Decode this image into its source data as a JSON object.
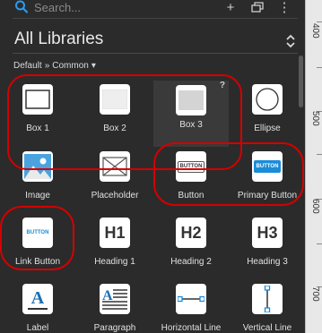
{
  "search": {
    "placeholder": "Search..."
  },
  "toolbar": {
    "add_label": "+",
    "more_label": "⋮"
  },
  "library": {
    "title": "All Libraries"
  },
  "breadcrumb": {
    "root": "Default",
    "sep": "»",
    "current": "Common",
    "caret": "▾"
  },
  "ruler": {
    "marks": [
      "400",
      "500",
      "600",
      "700"
    ]
  },
  "items": [
    {
      "label": "Box 1",
      "icon": "box-outline-icon"
    },
    {
      "label": "Box 2",
      "icon": "box-light-icon"
    },
    {
      "label": "Box 3",
      "icon": "box-gray-icon",
      "badge": "?"
    },
    {
      "label": "Ellipse",
      "icon": "ellipse-icon"
    },
    {
      "label": "Image",
      "icon": "image-icon"
    },
    {
      "label": "Placeholder",
      "icon": "placeholder-icon"
    },
    {
      "label": "Button",
      "icon": "button-icon",
      "text": "BUTTON"
    },
    {
      "label": "Primary Button",
      "icon": "primary-button-icon",
      "text": "BUTTON"
    },
    {
      "label": "Link Button",
      "icon": "link-button-icon",
      "text": "BUTTON"
    },
    {
      "label": "Heading 1",
      "icon": "heading-1-icon",
      "text": "H1"
    },
    {
      "label": "Heading 2",
      "icon": "heading-2-icon",
      "text": "H2"
    },
    {
      "label": "Heading 3",
      "icon": "heading-3-icon",
      "text": "H3"
    },
    {
      "label": "Label",
      "icon": "label-icon",
      "text": "A"
    },
    {
      "label": "Paragraph",
      "icon": "paragraph-icon",
      "text": "A"
    },
    {
      "label": "Horizontal Line",
      "icon": "horizontal-line-icon"
    },
    {
      "label": "Vertical Line",
      "icon": "vertical-line-icon"
    }
  ],
  "colors": {
    "accent": "#1a8cd8",
    "highlight_circle": "#d40000",
    "panel": "#2b2b2b"
  }
}
